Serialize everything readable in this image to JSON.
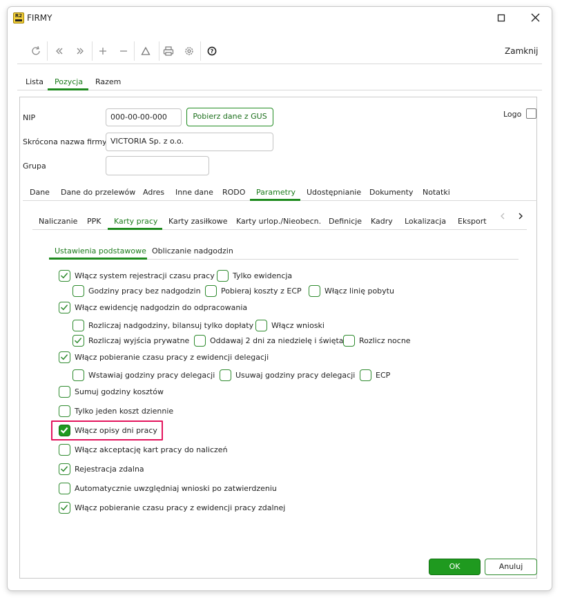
{
  "window": {
    "title": "FIRMY",
    "app_icon_text": "R2"
  },
  "toolbar": {
    "close_label": "Zamknij"
  },
  "main_tabs": [
    "Lista",
    "Pozycja",
    "Razem"
  ],
  "form": {
    "nip_label": "NIP",
    "nip_value": "000-00-00-000",
    "gus_button": "Pobierz dane z GUS",
    "short_name_label": "Skrócona nazwa firmy",
    "short_name_value": "VICTORIA Sp. z o.o.",
    "group_label": "Grupa",
    "group_value": "",
    "logo_label": "Logo"
  },
  "section_tabs": [
    "Dane",
    "Dane do przelewów",
    "Adres",
    "Inne dane",
    "RODO",
    "Parametry",
    "Udostępnianie",
    "Dokumenty",
    "Notatki"
  ],
  "param_tabs": [
    "Naliczanie",
    "PPK",
    "Karty pracy",
    "Karty zasiłkowe",
    "Karty urlop./Nieobecn.",
    "Definicje",
    "Kadry",
    "Lokalizacja",
    "Eksport"
  ],
  "sub_tabs": [
    "Ustawienia podstawowe",
    "Obliczanie nadgodzin"
  ],
  "options": {
    "o1": "Włącz system rejestracji czasu pracy",
    "o2": "Tylko ewidencja",
    "o3": "Godziny pracy bez nadgodzin",
    "o4": "Pobieraj koszty z ECP",
    "o5": "Włącz linię pobytu",
    "o6": "Włącz ewidencję nadgodzin do odpracowania",
    "o7": "Rozliczaj nadgodziny, bilansuj tylko dopłaty",
    "o8": "Włącz wnioski",
    "o9": "Rozliczaj wyjścia prywatne",
    "o10": "Oddawaj 2 dni za niedzielę i święta",
    "o11": "Rozlicz nocne",
    "o12": "Włącz pobieranie czasu pracy z ewidencji delegacji",
    "o13": "Wstawiaj godziny pracy delegacji",
    "o14": "Usuwaj godziny pracy delegacji",
    "o15": "ECP",
    "o16": "Sumuj godziny kosztów",
    "o17": "Tylko jeden koszt dziennie",
    "o18": "Włącz opisy dni pracy",
    "o19": "Włącz akceptację kart pracy do naliczeń",
    "o20": "Rejestracja zdalna",
    "o21": "Automatycznie uwzględniaj wnioski po zatwierdzeniu",
    "o22": "Włącz pobieranie czasu pracy z ewidencji pracy zdalnej"
  },
  "checked": {
    "o1": true,
    "o2": false,
    "o3": false,
    "o4": false,
    "o5": false,
    "o6": true,
    "o7": false,
    "o8": false,
    "o9": true,
    "o10": false,
    "o11": false,
    "o12": true,
    "o13": false,
    "o14": false,
    "o15": false,
    "o16": false,
    "o17": false,
    "o18": true,
    "o19": false,
    "o20": true,
    "o21": false,
    "o22": true
  },
  "buttons": {
    "ok": "OK",
    "cancel": "Anuluj"
  },
  "colors": {
    "accent": "#1e8a1e",
    "highlight": "#e3145c"
  }
}
